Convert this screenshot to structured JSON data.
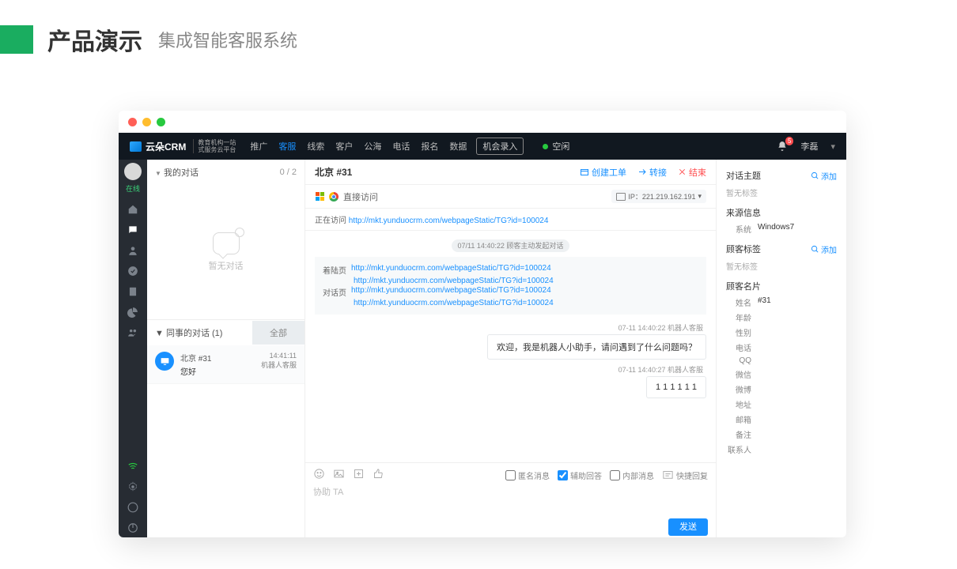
{
  "slide": {
    "title": "产品演示",
    "subtitle": "集成智能客服系统"
  },
  "nav": {
    "logo": "云朵CRM",
    "logo_sub1": "教育机构一站",
    "logo_sub2": "式服务云平台",
    "items": [
      "推广",
      "客服",
      "线索",
      "客户",
      "公海",
      "电话",
      "报名",
      "数据"
    ],
    "active": 1,
    "record_btn": "机会录入",
    "idle": "空闲",
    "badge": "5",
    "user": "李磊"
  },
  "iconbar": {
    "status": "在线"
  },
  "convs": {
    "my_title": "我的对话",
    "my_count": "0 / 2",
    "empty": "暂无对话",
    "peer_title": "同事的对话  (1)",
    "tab_all": "全部",
    "item": {
      "name": "北京 #31",
      "last": "您好",
      "time": "14:41:11",
      "agent": "机器人客服"
    }
  },
  "chat": {
    "title": "北京 #31",
    "actions": {
      "ticket": "创建工单",
      "transfer": "转接",
      "end": "结束"
    },
    "visit_label": "直接访问",
    "ip": "IP：221.219.162.191",
    "visiting_label": "正在访问",
    "visiting_url": "http://mkt.yunduocrm.com/webpageStatic/TG?id=100024",
    "sys_pill": "07/11 14:40:22  顾客主动发起对话",
    "info": {
      "landing_label": "着陆页",
      "dialog_label": "对话页",
      "url1": "http://mkt.yunduocrm.com/webpageStatic/TG?id=100024",
      "url2": "http://mkt.yunduocrm.com/webpageStatic/TG?id=100024",
      "url3": "http://mkt.yunduocrm.com/webpageStatic/TG?id=100024",
      "url4": "http://mkt.yunduocrm.com/webpageStatic/TG?id=100024"
    },
    "m1": {
      "ts": "07-11 14:40:22  机器人客服",
      "text": "欢迎，我是机器人小助手，请问遇到了什么问题吗？"
    },
    "m2": {
      "ts": "07-11 14:40:27  机器人客服",
      "text": "1 1 1 1 1 1"
    },
    "compose": {
      "anon": "匿名消息",
      "assist": "辅助回答",
      "internal": "内部消息",
      "quick": "快捷回复",
      "placeholder": "协助 TA",
      "send": "发送"
    }
  },
  "detail": {
    "topic": "对话主题",
    "add": "添加",
    "no_tag": "暂无标签",
    "source": "来源信息",
    "sys_k": "系统",
    "sys_v": "Windows7",
    "tags": "顾客标签",
    "card": "顾客名片",
    "name_k": "姓名",
    "name_v": "#31",
    "fields": [
      "年龄",
      "性别",
      "电话",
      "QQ",
      "微信",
      "微博",
      "地址",
      "邮箱",
      "备注",
      "联系人"
    ]
  }
}
